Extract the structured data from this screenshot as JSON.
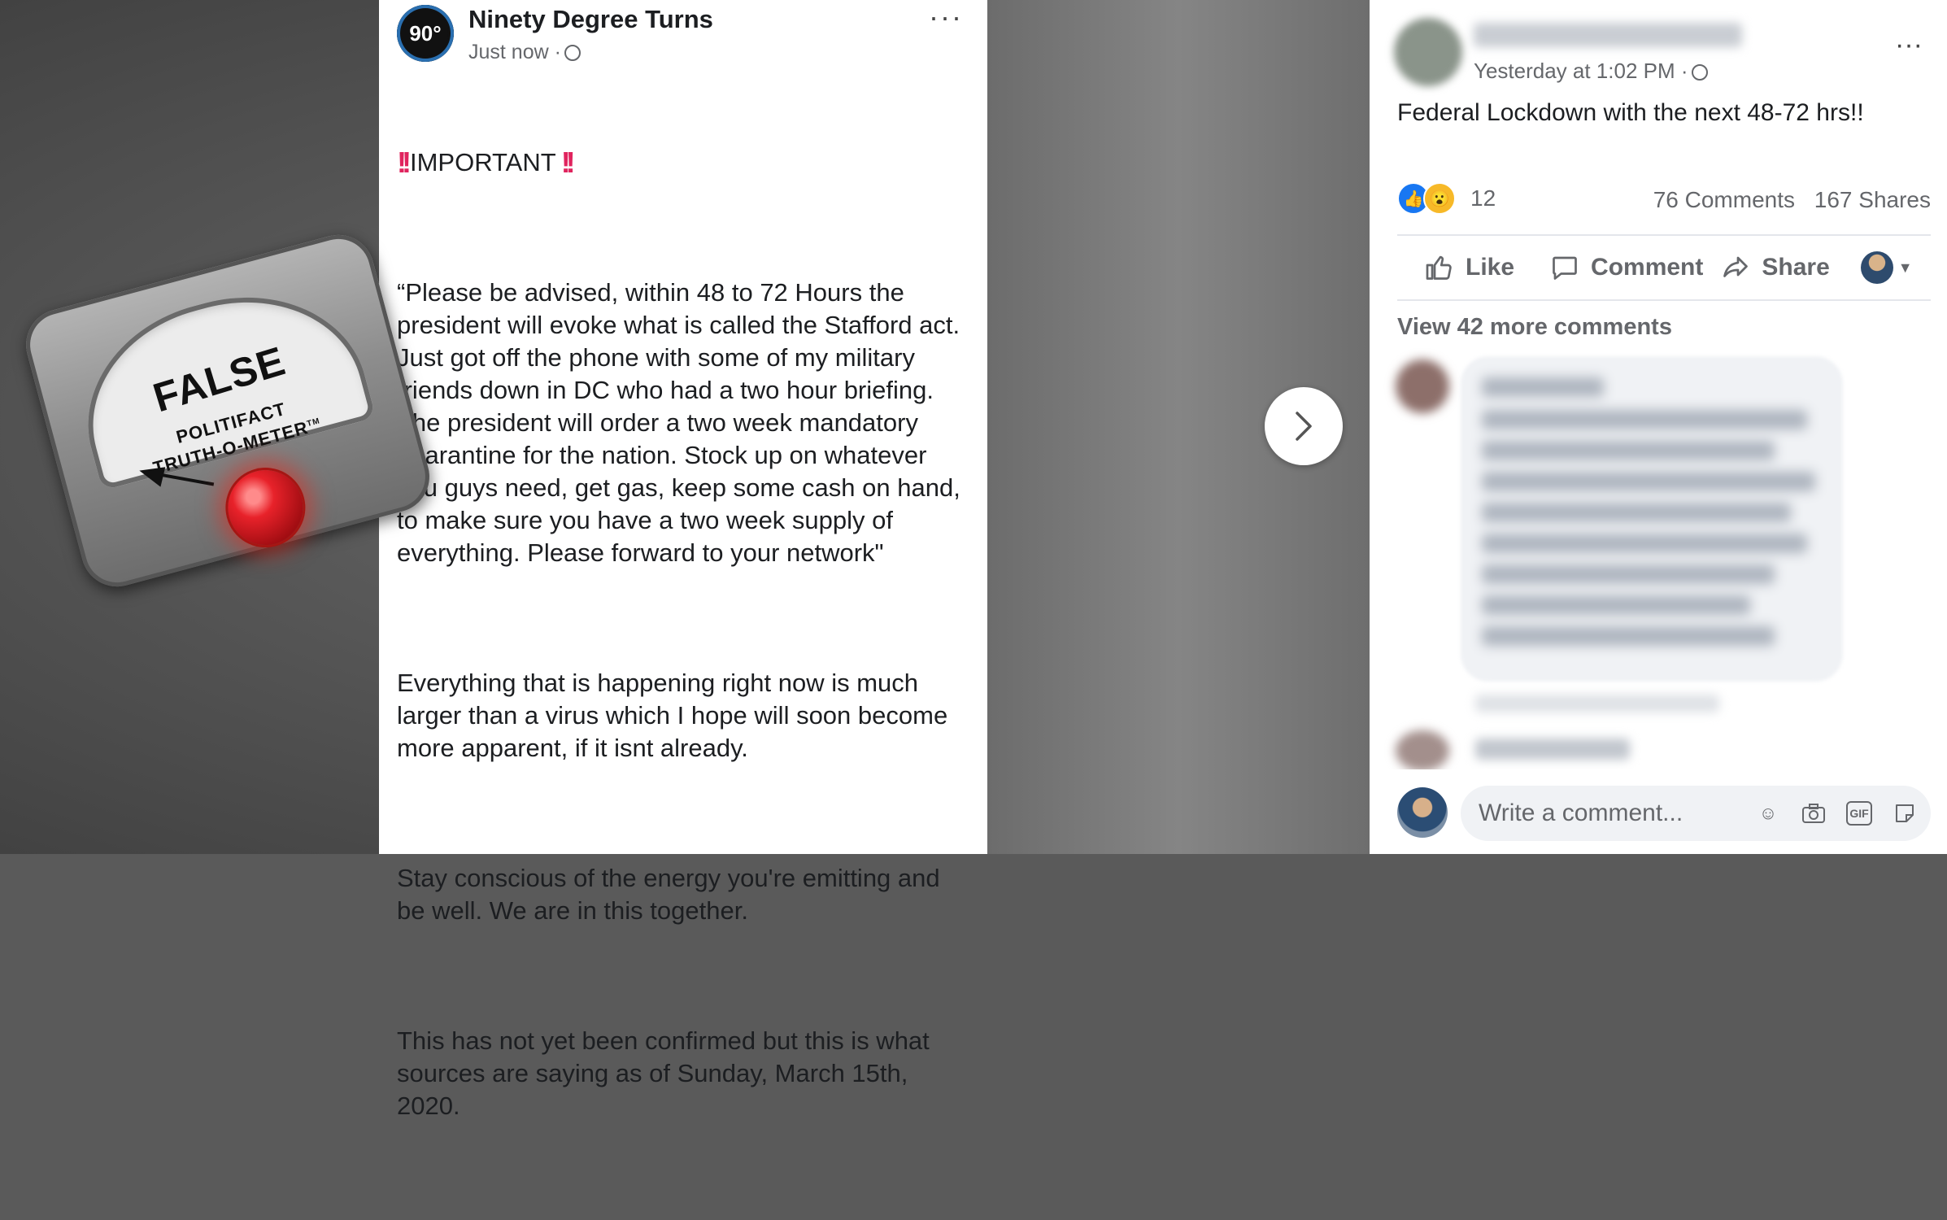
{
  "left_post": {
    "page_name": "Ninety Degree Turns",
    "avatar_text": "90°",
    "timestamp": "Just now ·",
    "more": "···",
    "important": "IMPORTANT",
    "paragraphs": [
      "“Please be advised, within 48 to 72 Hours the president will evoke what is called the Stafford act. Just got off the phone with some of my military friends down in DC who had a two hour briefing. The president will order a two week mandatory quarantine for the nation. Stock up on whatever you guys need, get gas, keep some cash on hand, to make sure you have a two week supply of everything. Please forward to your network\"",
      "Everything that is happening right now is much larger than a virus which I hope will soon become more apparent, if it isnt already.",
      "Stay conscious of the energy you're emitting and be well. We are in this together.",
      "This has not yet been confirmed but this is what sources are saying as of Sunday, March 15th, 2020."
    ]
  },
  "right_post": {
    "timestamp": "Yesterday at 1:02 PM ·",
    "more": "···",
    "text": "Federal Lockdown with the next 48-72 hrs!!",
    "reaction_count": "12",
    "comments_count": "76 Comments",
    "shares_count": "167 Shares",
    "actions": {
      "like": "Like",
      "comment": "Comment",
      "share": "Share"
    },
    "view_more": "View 42 more comments",
    "write_placeholder": "Write a comment...",
    "gif_label": "GIF"
  },
  "meter": {
    "rating": "FALSE",
    "brand_line1": "POLITIFACT",
    "brand_line2": "TRUTH-O-METER",
    "tm": "TM"
  },
  "colors": {
    "facebook_blue": "#1877f2",
    "knob_red": "#e8222a",
    "important_red": "#e0245e"
  }
}
